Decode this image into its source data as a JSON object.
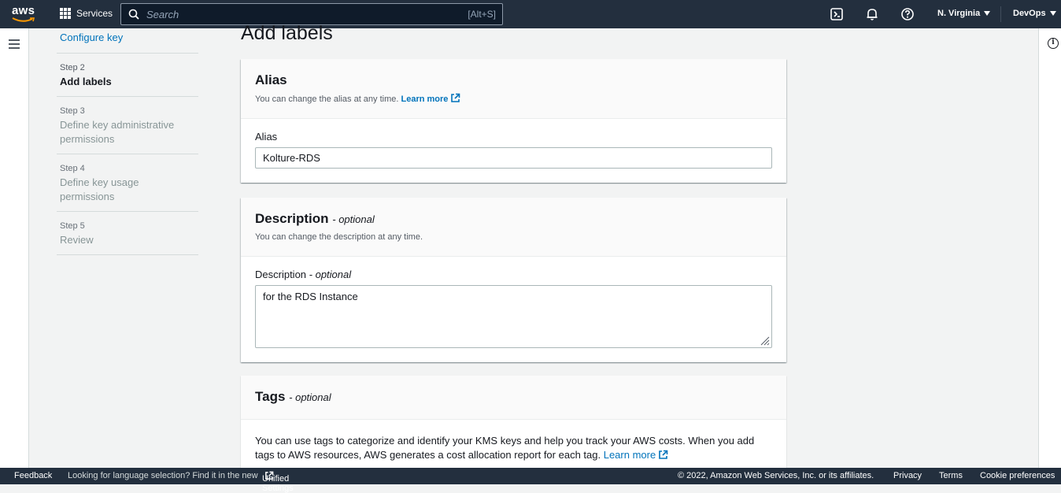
{
  "topnav": {
    "logo_text": "aws",
    "services_label": "Services",
    "search_placeholder": "Search",
    "search_shortcut": "[Alt+S]",
    "region": "N. Virginia",
    "account": "DevOps"
  },
  "steps": {
    "prev_link": "Configure key",
    "items": [
      {
        "num": "Step 2",
        "title": "Add labels"
      },
      {
        "num": "Step 3",
        "title": "Define key administrative permissions"
      },
      {
        "num": "Step 4",
        "title": "Define key usage permissions"
      },
      {
        "num": "Step 5",
        "title": "Review"
      }
    ]
  },
  "page": {
    "title": "Add labels"
  },
  "alias_panel": {
    "title": "Alias",
    "description": "You can change the alias at any time.",
    "learn_more": "Learn more",
    "field_label": "Alias",
    "field_value": "Kolture-RDS"
  },
  "description_panel": {
    "title": "Description",
    "optional": "- optional",
    "description": "You can change the description at any time.",
    "field_label": "Description",
    "field_optional": "- optional",
    "field_value": "for the RDS Instance"
  },
  "tags_panel": {
    "title": "Tags",
    "optional": "- optional",
    "body": "You can use tags to categorize and identify your KMS keys and help you track your AWS costs. When you add tags to AWS resources, AWS generates a cost allocation report for each tag.",
    "learn_more": "Learn more"
  },
  "footer": {
    "feedback": "Feedback",
    "language_prompt": "Looking for language selection? Find it in the new",
    "unified_settings": "Unified Settings",
    "copyright": "© 2022, Amazon Web Services, Inc. or its affiliates.",
    "privacy": "Privacy",
    "terms": "Terms",
    "cookie": "Cookie preferences"
  },
  "colors": {
    "nav_bg": "#232f3e",
    "link": "#0073bb",
    "page_bg": "#f2f3f3"
  }
}
